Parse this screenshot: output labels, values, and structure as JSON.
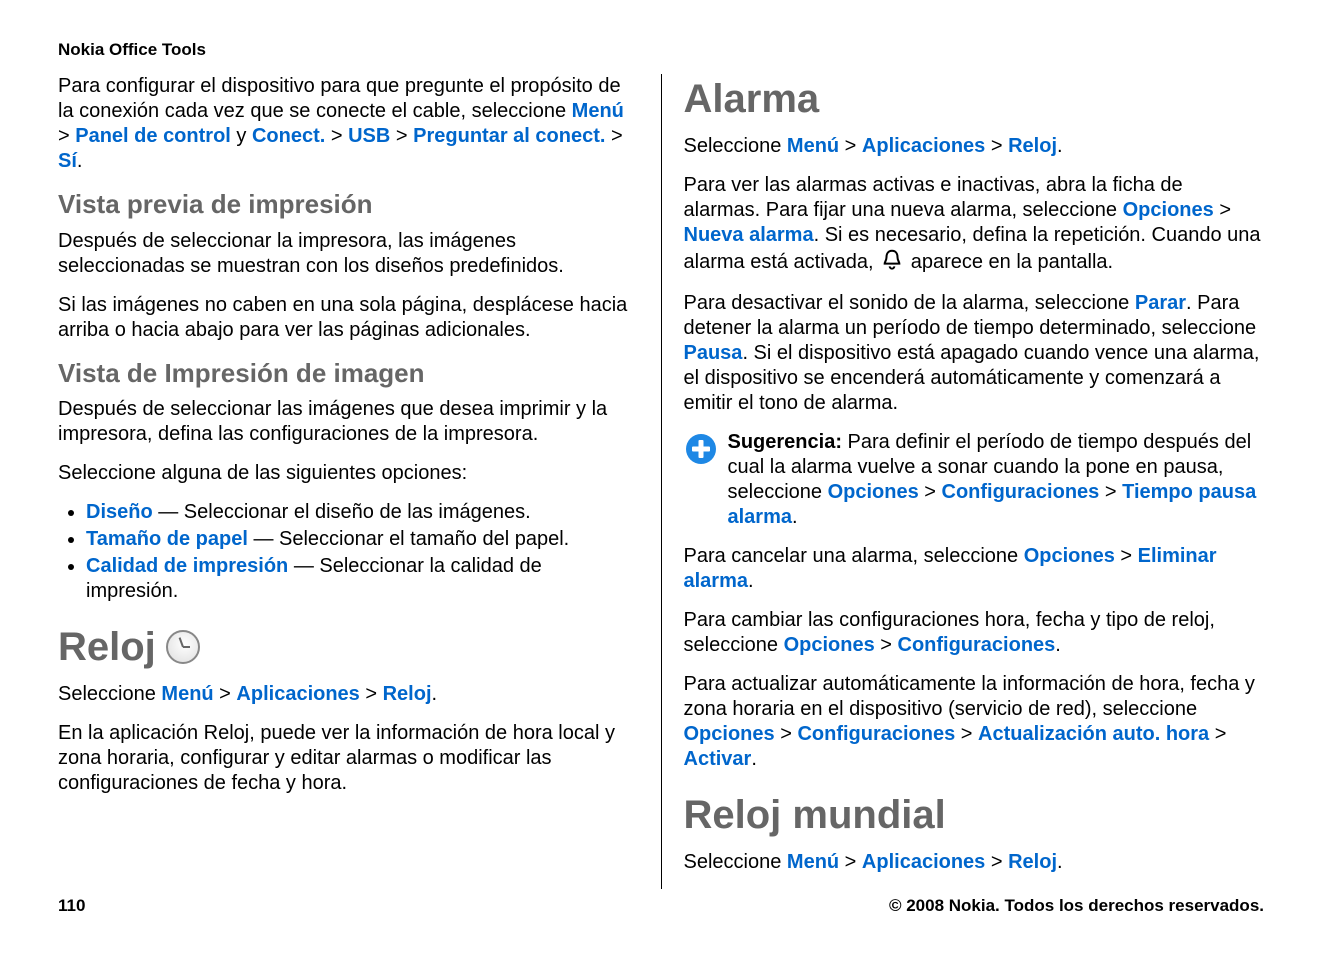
{
  "header": "Nokia Office Tools",
  "left": {
    "p1_a": "Para configurar el dispositivo para que pregunte el propósito de la conexión cada vez que se conecte el cable, seleccione ",
    "menu": "Menú",
    "panel_de_control": "Panel de control",
    "y": " y ",
    "conect": "Conect.",
    "usb": "USB",
    "preguntar_al_conect": "Preguntar al conect.",
    "si": "Sí",
    "h2_preview": "Vista previa de impresión",
    "p2": "Después de seleccionar la impresora, las imágenes seleccionadas se muestran con los diseños predefinidos.",
    "p3": "Si las imágenes no caben en una sola página, desplácese hacia arriba o hacia abajo para ver las páginas adicionales.",
    "h2_printview": "Vista de Impresión de imagen",
    "p4": "Después de seleccionar las imágenes que desea imprimir y la impresora, defina las configuraciones de la impresora.",
    "p5": "Seleccione alguna de las siguientes opciones:",
    "li1_label": "Diseño",
    "li1_text": "  — Seleccionar el diseño de las imágenes.",
    "li2_label": "Tamaño de papel",
    "li2_text": "  — Seleccionar el tamaño del papel.",
    "li3_label": "Calidad de impresión",
    "li3_text": "  — Seleccionar la calidad de impresión.",
    "h1_clock": "Reloj",
    "p6_a": "Seleccione ",
    "aplicaciones": "Aplicaciones",
    "reloj": "Reloj",
    "p7": "En la aplicación Reloj, puede ver la información de hora local y zona horaria, configurar y editar alarmas o modificar las configuraciones de fecha y hora."
  },
  "right": {
    "h1_alarm": "Alarma",
    "p1_a": "Seleccione ",
    "menu": "Menú",
    "aplicaciones": "Aplicaciones",
    "reloj": "Reloj",
    "p2_a": "Para ver las alarmas activas e inactivas, abra la ficha de alarmas. Para fijar una nueva alarma, seleccione ",
    "opciones": "Opciones",
    "nueva_alarma": "Nueva alarma",
    "p2_b": ". Si es necesario, defina la repetición. Cuando una alarma está activada, ",
    "p2_c": " aparece en la pantalla.",
    "p3_a": "Para desactivar el sonido de la alarma, seleccione ",
    "parar": "Parar",
    "p3_b": ". Para detener la alarma un período de tiempo determinado, seleccione ",
    "pausa": "Pausa",
    "p3_c": ". Si el dispositivo está apagado cuando vence una alarma, el dispositivo se encenderá automáticamente y comenzará a emitir el tono de alarma.",
    "tip_label": "Sugerencia: ",
    "tip_a": "Para definir el período de tiempo después del cual la alarma vuelve a sonar cuando la pone en pausa, seleccione ",
    "configuraciones": "Configuraciones",
    "tiempo_pausa": "Tiempo pausa alarma",
    "p4_a": "Para cancelar una alarma, seleccione ",
    "eliminar_alarma": "Eliminar alarma",
    "p5_a": "Para cambiar las configuraciones hora, fecha y tipo de reloj, seleccione ",
    "p6_a": "Para actualizar automáticamente la información de hora, fecha y zona horaria en el dispositivo (servicio de red), seleccione ",
    "actualizacion_auto": "Actualización auto. hora",
    "activar": "Activar",
    "h1_worldclock": "Reloj mundial"
  },
  "footer": {
    "page": "110",
    "copyright": "© 2008 Nokia. Todos los derechos reservados."
  },
  "gt": " > "
}
